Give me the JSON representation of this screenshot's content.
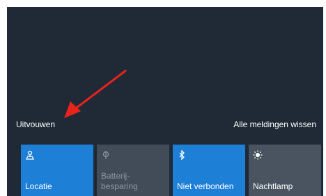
{
  "action_center": {
    "expand_label": "Uitvouwen",
    "clear_all_label": "Alle meldingen wissen"
  },
  "quick_actions": [
    {
      "label": "Locatie",
      "state": "active",
      "icon": "location-icon"
    },
    {
      "label": "Batterij-\nbesparing",
      "state": "disabled",
      "icon": "battery-saver-icon"
    },
    {
      "label": "Niet verbonden",
      "state": "active",
      "icon": "bluetooth-icon"
    },
    {
      "label": "Nachtlamp",
      "state": "inactive",
      "icon": "night-light-icon"
    }
  ],
  "annotation": {
    "arrow_color": "#e8231c"
  },
  "colors": {
    "accent": "#1e7fd6",
    "panel_bg": "#1f2a36",
    "tile_inactive": "#4a5461"
  }
}
